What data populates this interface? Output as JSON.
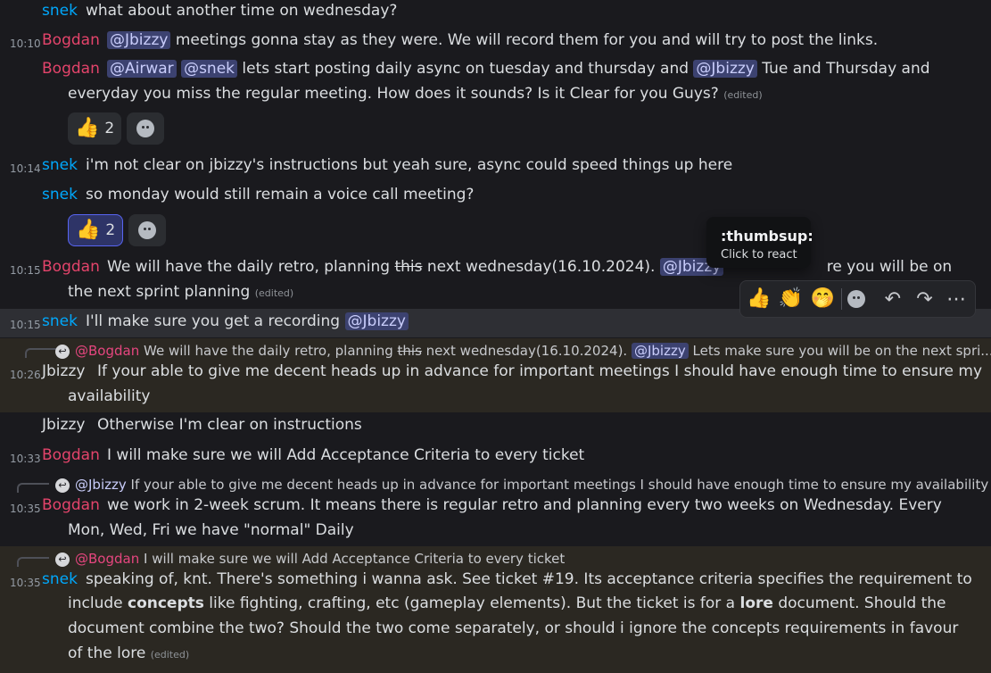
{
  "colors": {
    "background": "#1a1a1e",
    "bogdan": "#e4446b",
    "snek": "#00a8fc",
    "jbizzy": "#dbdee1",
    "mention_bg": "#3c4270",
    "highlight": "#2b2822"
  },
  "messages": [
    {
      "time": "",
      "author": "snek",
      "lines": [
        {
          "text": "what about another time on wednesday?"
        }
      ]
    },
    {
      "time": "10:10",
      "author": "Bogdan",
      "lines": [
        {
          "mention": "@Jbizzy",
          "text": "meetings gonna stay as they were. We will record them for you and will try to post the links."
        }
      ]
    },
    {
      "time": "",
      "author": "Bogdan",
      "lines": [
        {
          "mentions": [
            "@Airwar",
            "@snek"
          ],
          "text": "lets start posting daily async on tuesday and thursday and",
          "mention2": "@Jbizzy",
          "text2": "Tue and Thursday and"
        },
        {
          "text": "everyday you miss the regular meeting. How does it sounds? Is it Clear for you Guys?",
          "edited": "(edited)"
        }
      ],
      "reactions": [
        {
          "emoji": "👍",
          "count": "2",
          "active": false
        }
      ]
    },
    {
      "time": "10:14",
      "author": "snek",
      "lines": [
        {
          "text": "i'm not clear on jbizzy's instructions but yeah sure, async could speed things up here"
        }
      ]
    },
    {
      "time": "",
      "author": "snek",
      "lines": [
        {
          "text": "so monday would still remain a voice call meeting?"
        }
      ],
      "reactions": [
        {
          "emoji": "👍",
          "count": "2",
          "active": true
        }
      ]
    },
    {
      "time": "10:15",
      "author": "Bogdan",
      "lines": [
        {
          "text": "We will have the daily retro, planning",
          "strike": "this",
          "text2": "next wednesday(16.10.2024).",
          "mention": "@Jbizzy",
          "tail": "re you will be on"
        },
        {
          "text": "the next sprint planning",
          "edited": "(edited)"
        }
      ]
    },
    {
      "time": "10:15",
      "author": "snek",
      "lines": [
        {
          "text": "I'll make sure you get a recording",
          "mention": "@Jbizzy"
        }
      ]
    },
    {
      "time": "10:26",
      "author": "Jbizzy",
      "reply": {
        "mention": "@Bogdan",
        "text_a": "We will have the daily retro, planning",
        "strike": "this",
        "text_b": "next wednesday(16.10.2024).",
        "mention2": "@Jbizzy",
        "text_c": "Lets make sure you will be on the next spri..."
      },
      "lines": [
        {
          "text": "If your able to give me decent heads up in advance for important meetings I should have enough time to ensure my"
        },
        {
          "text": "availability"
        }
      ]
    },
    {
      "time": "",
      "author": "Jbizzy",
      "lines": [
        {
          "text": "Otherwise I'm clear on instructions"
        }
      ]
    },
    {
      "time": "10:33",
      "author": "Bogdan",
      "lines": [
        {
          "text": "I will make sure we will Add Acceptance Criteria to every ticket"
        }
      ]
    },
    {
      "time": "10:35",
      "author": "Bogdan",
      "reply": {
        "mention": "@Jbizzy",
        "text_a": "If your able to give me decent heads up in advance for important meetings I should have enough time to ensure my availability"
      },
      "lines": [
        {
          "text": "we work in 2-week scrum. It means there is regular retro and planning every two weeks on Wednesday. Every"
        },
        {
          "text": "Mon, Wed, Fri we have \"normal\" Daily"
        }
      ]
    },
    {
      "time": "10:35",
      "author": "snek",
      "reply": {
        "mention": "@Bogdan",
        "text_a": "I will make sure we will Add Acceptance Criteria to every ticket"
      },
      "lines": [
        {
          "text": "speaking of, knt. There's something i wanna ask. See ticket #19. Its acceptance criteria specifies the requirement to"
        },
        {
          "text_a": "include",
          "bold": "concepts",
          "text_b": "like fighting, crafting, etc (gameplay elements). But the ticket is for a",
          "bold2": "lore",
          "text_c": "document. Should the"
        },
        {
          "text": "document combine the two? Should the two come separately, or should i ignore the concepts requirements in favour"
        },
        {
          "text": "of the lore",
          "edited": "(edited)"
        }
      ]
    }
  ],
  "tooltip": {
    "title": ":thumbsup:",
    "subtitle": "Click to react"
  },
  "toolbar": {
    "emoji1": "👍",
    "emoji2": "👏",
    "emoji3": "🤭",
    "add_reaction_icon": "smile-plus-icon",
    "reply_icon": "reply-icon",
    "forward_icon": "forward-icon",
    "more_icon": "more-icon"
  }
}
